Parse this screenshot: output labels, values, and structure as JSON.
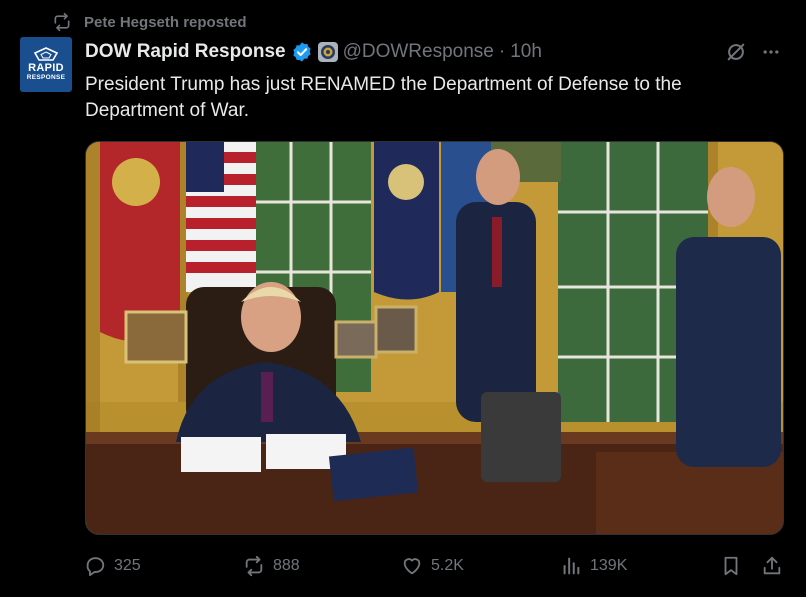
{
  "repost": {
    "label": "Pete Hegseth reposted",
    "icon": "repost-icon"
  },
  "author": {
    "avatar_line1": "RAPID",
    "avatar_line2": "RESPONSE",
    "display_name": "DOW Rapid Response",
    "handle": "@DOWResponse",
    "separator": "·",
    "time": "10h"
  },
  "tweet": {
    "text": "President Trump has just RENAMED the Department of Defense to the Department of War."
  },
  "media": {
    "type": "photo",
    "alt_subject": "Oval Office signing"
  },
  "actions": {
    "replies": "325",
    "reposts": "888",
    "likes": "5.2K",
    "views": "139K"
  },
  "colors": {
    "background": "#000000",
    "text": "#e7e9ea",
    "muted": "#71767b",
    "verified": "#1d9bf0"
  }
}
